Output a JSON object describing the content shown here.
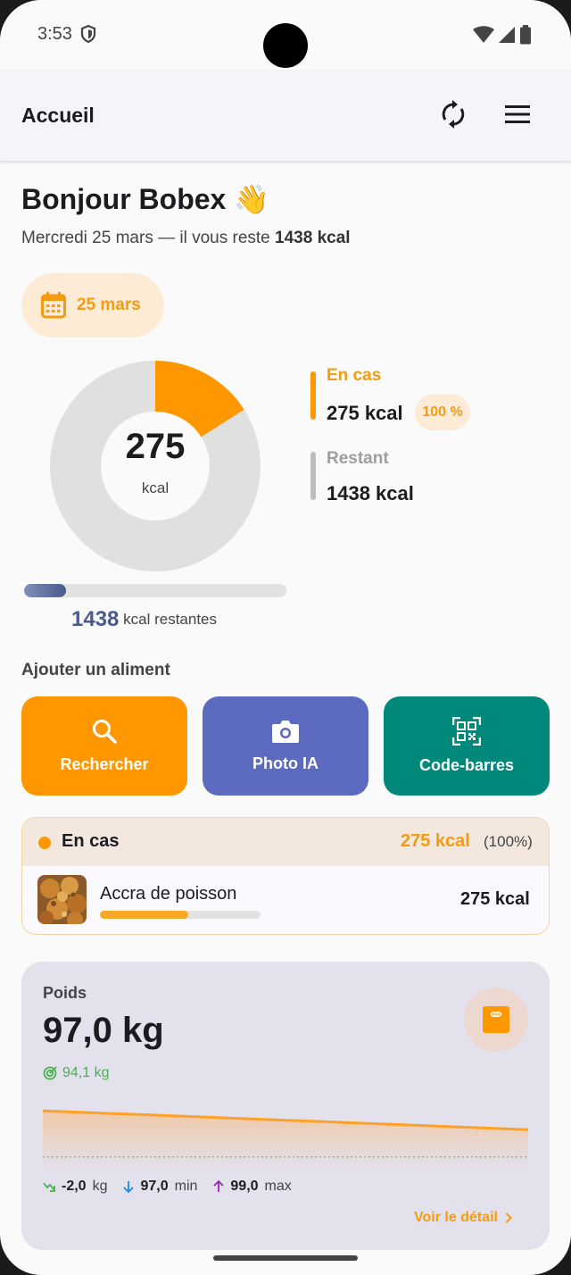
{
  "status_bar": {
    "time": "3:53"
  },
  "app_bar": {
    "title": "Accueil"
  },
  "greeting": {
    "title": "Bonjour Bobex 👋",
    "subtitle_prefix": "Mercredi 25 mars — il vous reste ",
    "subtitle_value": "1438 kcal"
  },
  "date_chip": {
    "label": "25 mars"
  },
  "summary": {
    "consumed": "275",
    "unit": "kcal",
    "consumed_fraction": 0.16,
    "legend": [
      {
        "title": "En cas",
        "value": "275 kcal",
        "badge": "100 %",
        "color": "#ff9800"
      },
      {
        "title": "Restant",
        "value": "1438 kcal",
        "color": "#bdbdbd"
      }
    ],
    "remaining_number": "1438",
    "remaining_suffix": "kcal restantes",
    "remaining_fraction": 0.16
  },
  "add_food": {
    "title": "Ajouter un aliment",
    "buttons": [
      {
        "label": "Rechercher",
        "color": "#ff9800",
        "icon": "search-icon"
      },
      {
        "label": "Photo IA",
        "color": "#5c6bc0",
        "icon": "camera-icon"
      },
      {
        "label": "Code-barres",
        "color": "#00897b",
        "icon": "qr-code-icon"
      }
    ]
  },
  "meal": {
    "name": "En cas",
    "kcal": "275 kcal",
    "pct": "(100%)",
    "items": [
      {
        "name": "Accra de poisson",
        "kcal": "275 kcal",
        "fraction": 0.55
      }
    ]
  },
  "weight": {
    "label": "Poids",
    "value": "97,0 kg",
    "target": "94,1 kg",
    "stats": [
      {
        "value": "-2,0",
        "unit": "kg"
      },
      {
        "value": "97,0",
        "unit": "min"
      },
      {
        "value": "99,0",
        "unit": "max"
      }
    ],
    "detail_link": "Voir le détail"
  },
  "chart_data": {
    "type": "area",
    "series": [
      {
        "values": [
          99.0,
          97.0
        ]
      }
    ],
    "target_line": 94.1
  }
}
